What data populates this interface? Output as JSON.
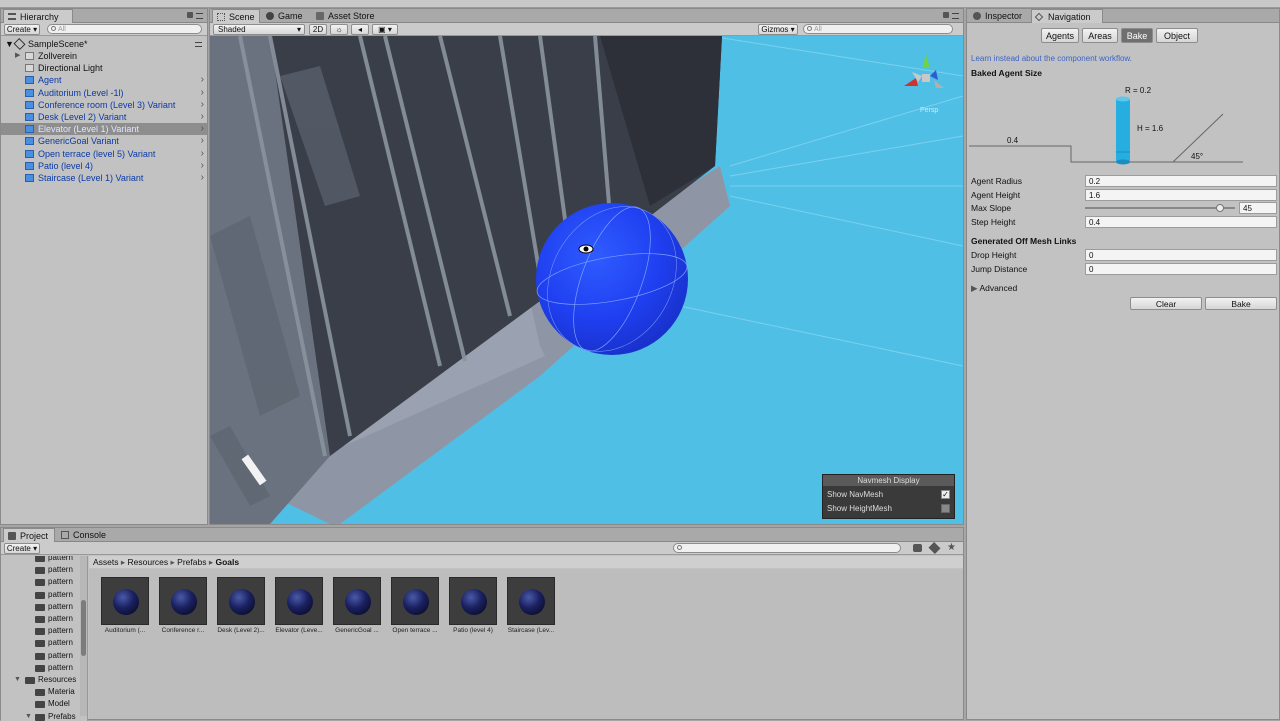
{
  "hierarchy": {
    "tab": "Hierarchy",
    "create": "Create",
    "search_placeholder": "All",
    "scene": "SampleScene*",
    "items": [
      {
        "label": "Zollverein",
        "selected": false,
        "style": "plain"
      },
      {
        "label": "Directional Light",
        "selected": false,
        "style": "plain"
      },
      {
        "label": "Agent",
        "selected": false,
        "style": "prefab"
      },
      {
        "label": "Auditorium (Level -1l)",
        "selected": false,
        "style": "prefab"
      },
      {
        "label": "Conference room (Level 3)  Variant",
        "selected": false,
        "style": "prefab"
      },
      {
        "label": "Desk (Level 2)  Variant",
        "selected": false,
        "style": "prefab"
      },
      {
        "label": "Elevator (Level 1)  Variant",
        "selected": true,
        "style": "prefab"
      },
      {
        "label": "GenericGoal Variant",
        "selected": false,
        "style": "prefab"
      },
      {
        "label": "Open terrace (level 5)  Variant",
        "selected": false,
        "style": "prefab"
      },
      {
        "label": "Patio (level 4)",
        "selected": false,
        "style": "prefab"
      },
      {
        "label": "Staircase (Level 1)  Variant",
        "selected": false,
        "style": "prefab"
      }
    ]
  },
  "scene_view": {
    "tabs": [
      "Scene",
      "Game",
      "Asset Store"
    ],
    "shading": "Shaded",
    "mode_2d": "2D",
    "gizmos": "Gizmos",
    "search_placeholder": "All",
    "persp": "Persp",
    "navmesh_display": {
      "title": "Navmesh Display",
      "show_navmesh": "Show NavMesh",
      "show_navmesh_checked": true,
      "show_heightmesh": "Show HeightMesh",
      "show_heightmesh_checked": false
    }
  },
  "inspector": {
    "tabs": [
      "Inspector",
      "Navigation"
    ],
    "subtabs": [
      "Agents",
      "Areas",
      "Bake",
      "Object"
    ],
    "active_subtab": "Bake",
    "hint": "Learn instead about the component workflow.",
    "baked_agent_size": "Baked Agent Size",
    "diagram": {
      "r": "R = 0.2",
      "h": "H = 1.6",
      "step": "0.4",
      "slope": "45°"
    },
    "fields": [
      {
        "label": "Agent Radius",
        "value": "0.2"
      },
      {
        "label": "Agent Height",
        "value": "1.6"
      },
      {
        "label": "Max Slope",
        "value": "45"
      },
      {
        "label": "Step Height",
        "value": "0.4"
      }
    ],
    "max_slope_fraction": 0.9,
    "offmesh_title": "Generated Off Mesh Links",
    "offmesh_fields": [
      {
        "label": "Drop Height",
        "value": "0"
      },
      {
        "label": "Jump Distance",
        "value": "0"
      }
    ],
    "advanced": "Advanced",
    "clear": "Clear",
    "bake": "Bake"
  },
  "project": {
    "tabs": [
      "Project",
      "Console"
    ],
    "create": "Create",
    "breadcrumb": [
      "Assets",
      "Resources",
      "Prefabs",
      "Goals"
    ],
    "tree": [
      "pattern",
      "pattern",
      "pattern",
      "pattern",
      "pattern",
      "pattern",
      "pattern",
      "pattern",
      "pattern",
      "pattern",
      "Resources",
      "Materia",
      "Model",
      "Prefabs"
    ],
    "assets": [
      "Auditorium (...",
      "Conference r...",
      "Desk (Level 2)...",
      "Elevator (Leve...",
      "GenericGoal ...",
      "Open terrace ...",
      "Patio (level 4)",
      "Staircase (Lev..."
    ]
  }
}
